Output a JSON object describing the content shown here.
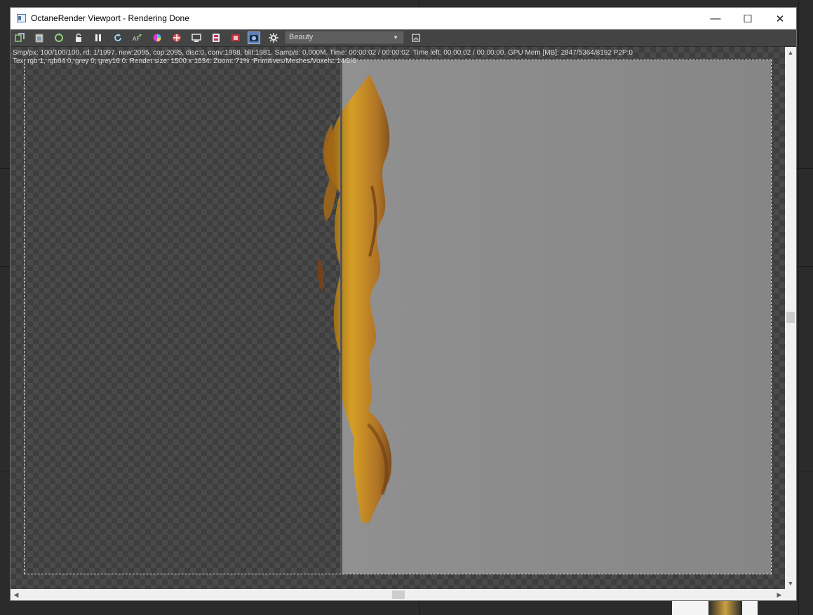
{
  "window": {
    "title": "OctaneRender Viewport - Rendering Done",
    "controls": {
      "minimize": "—",
      "maximize": "☐",
      "close": "✕"
    }
  },
  "toolbar": {
    "buttons": [
      {
        "name": "send-scene-icon"
      },
      {
        "name": "clipboard-icon"
      },
      {
        "name": "restart-render-icon"
      },
      {
        "name": "lock-icon"
      },
      {
        "name": "pause-icon"
      },
      {
        "name": "reload-icon"
      },
      {
        "name": "aov-icon"
      },
      {
        "name": "color-wheel-icon"
      },
      {
        "name": "region-icon"
      },
      {
        "name": "display-icon"
      },
      {
        "name": "film-icon"
      },
      {
        "name": "film-red-icon"
      },
      {
        "name": "camera-active-icon",
        "active": true
      },
      {
        "name": "settings-gear-icon"
      }
    ],
    "pass_dropdown": {
      "value": "Beauty"
    },
    "extra_button": {
      "name": "save-image-icon"
    }
  },
  "stats": {
    "line1": "Smp/px: 100/100/100.   rd: 1/1997.   new:2095, cop:2095, disc:0, conv:1998, blit:1981.   Samp/s: 0,000M.   Time: 00:00:02 / 00:00:02.   Time left: 00:00:02 / 00:00:00.   GPU Mem [MB]: 2847/5364/8192 P2P:0",
    "line2": "Tex: rgb 1, rgb64 0, grey 0, grey16 0.   Render size: 1500 x 1034.   Zoom: 71%.   Primitives/Meshes/Voxels: 14/2/0"
  },
  "scrollbars": {
    "up": "▲",
    "down": "▼",
    "left": "◀",
    "right": "▶"
  },
  "colors": {
    "viewport_bg": "#3e3e3e",
    "render_gray": "#8c8c8c",
    "fire": "#d9a020",
    "active_button": "#5b7fb3"
  }
}
